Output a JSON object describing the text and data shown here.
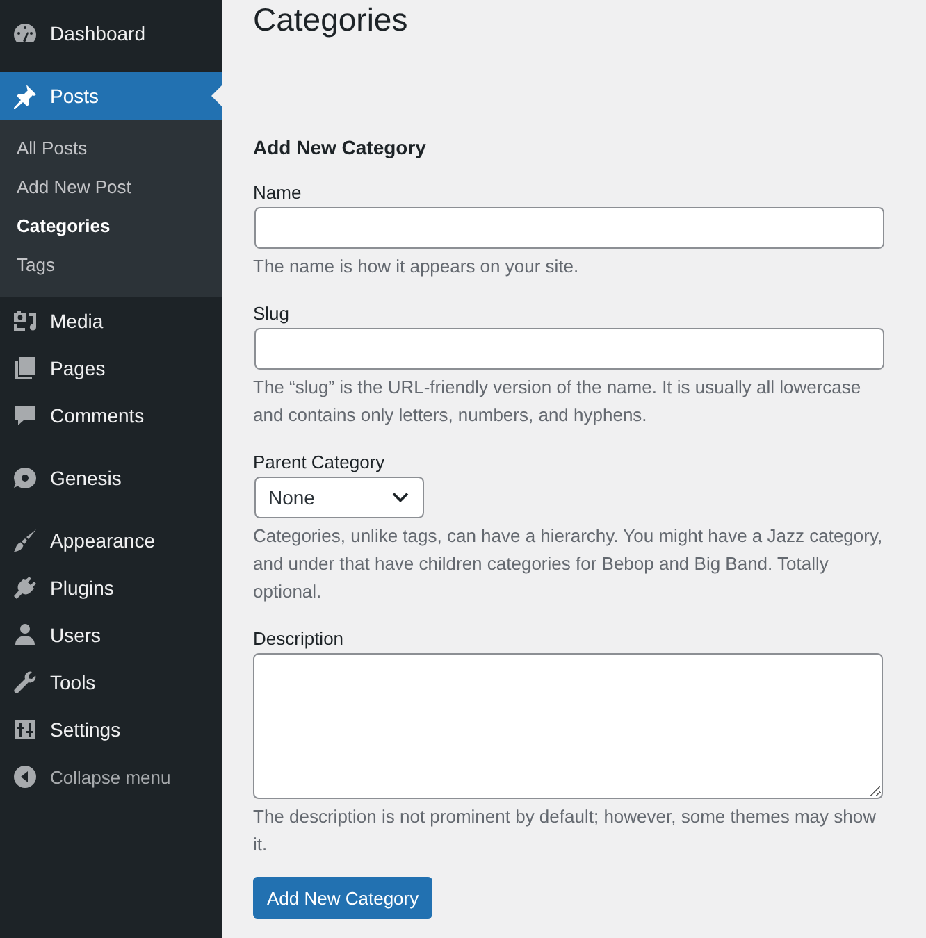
{
  "sidebar": {
    "groups": [
      {
        "items": [
          {
            "label": "Dashboard",
            "selected": false
          }
        ]
      },
      {
        "items": [
          {
            "label": "Posts",
            "selected": true,
            "children": [
              {
                "label": "All Posts",
                "selected": false
              },
              {
                "label": "Add New Post",
                "selected": false
              },
              {
                "label": "Categories",
                "selected": true
              },
              {
                "label": "Tags",
                "selected": false
              }
            ]
          },
          {
            "label": "Media",
            "selected": false
          },
          {
            "label": "Pages",
            "selected": false
          },
          {
            "label": "Comments",
            "selected": false
          }
        ]
      },
      {
        "items": [
          {
            "label": "Genesis",
            "selected": false
          }
        ]
      },
      {
        "items": [
          {
            "label": "Appearance",
            "selected": false
          },
          {
            "label": "Plugins",
            "selected": false
          },
          {
            "label": "Users",
            "selected": false
          },
          {
            "label": "Tools",
            "selected": false
          },
          {
            "label": "Settings",
            "selected": false
          }
        ]
      }
    ],
    "collapse_button": {
      "label": "Collapse menu"
    }
  },
  "page": {
    "title": "Categories"
  },
  "form": {
    "heading": "Add New Category",
    "fields": [
      {
        "kind": "text",
        "label": "Name",
        "help": "The name is how it appears on your site."
      },
      {
        "kind": "text",
        "label": "Slug",
        "help": "The “slug” is the URL-friendly version of the name. It is usually all lowercase and contains only letters, numbers, and hyphens."
      },
      {
        "kind": "select",
        "label": "Parent Category",
        "value": "None",
        "help": "Categories, unlike tags, can have a hierarchy. You might have a Jazz category, and under that have children categories for Bebop and Big Band. Totally optional."
      },
      {
        "kind": "textarea",
        "label": "Description",
        "help": "The description is not prominent by default; however, some themes may show it."
      }
    ],
    "submit_button": "Add New Category"
  }
}
